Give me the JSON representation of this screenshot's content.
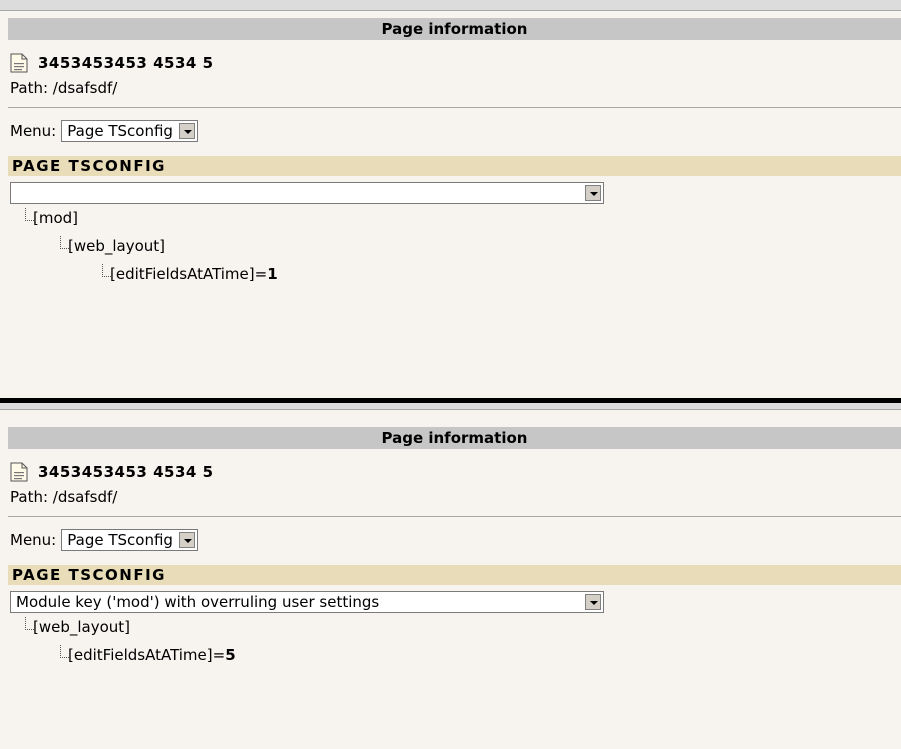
{
  "panels": [
    {
      "header": "Page information",
      "page_title": "3453453453 4534 5",
      "path": "Path: /dsafsdf/",
      "menu_label": "Menu:",
      "menu_value": "Page TSconfig",
      "section_title": "PAGE TSCONFIG",
      "selector_value": "",
      "tree": [
        {
          "key": "[mod]",
          "value": ""
        },
        {
          "key": "[web_layout]",
          "value": ""
        },
        {
          "key": "[editFieldsAtATime]=",
          "value": "1"
        }
      ]
    },
    {
      "header": "Page information",
      "page_title": "3453453453 4534 5",
      "path": "Path: /dsafsdf/",
      "menu_label": "Menu:",
      "menu_value": "Page TSconfig",
      "section_title": "PAGE TSCONFIG",
      "selector_value": "Module key ('mod') with overruling user settings",
      "tree": [
        {
          "key": "[web_layout]",
          "value": ""
        },
        {
          "key": "[editFieldsAtATime]=",
          "value": "5"
        }
      ]
    }
  ]
}
